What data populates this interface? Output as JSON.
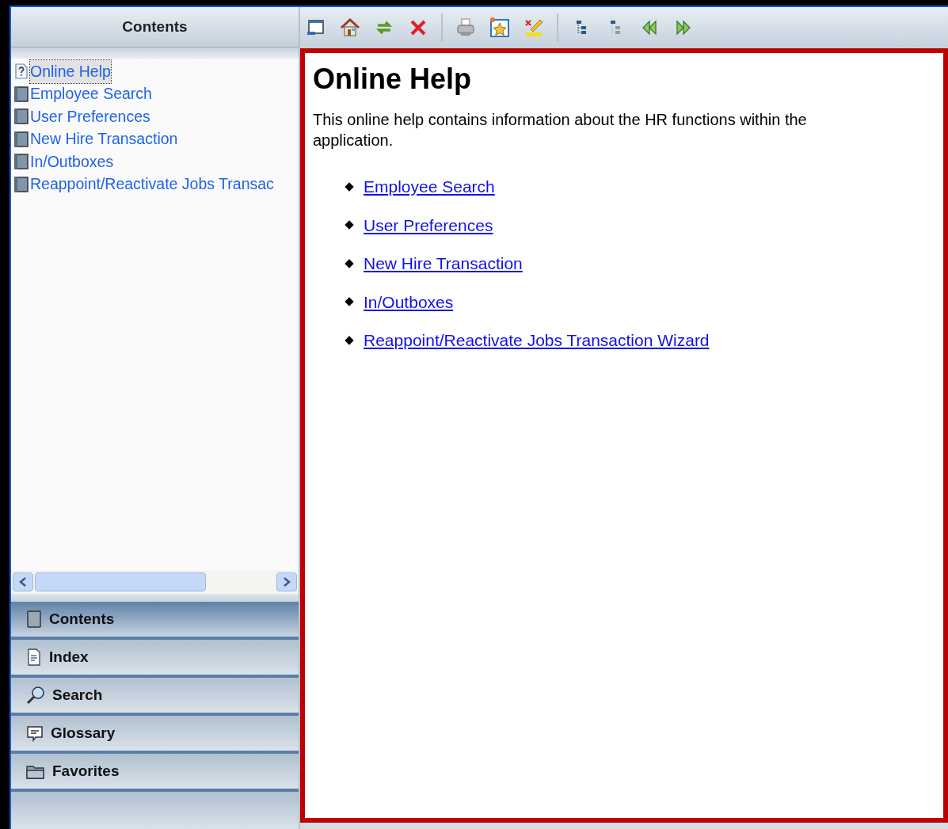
{
  "sidebar": {
    "title": "Contents",
    "tree": [
      {
        "label": "Online Help",
        "kind": "page",
        "selected": true
      },
      {
        "label": "Employee Search",
        "kind": "book",
        "selected": false
      },
      {
        "label": "User Preferences",
        "kind": "book",
        "selected": false
      },
      {
        "label": "New Hire Transaction",
        "kind": "book",
        "selected": false
      },
      {
        "label": "In/Outboxes",
        "kind": "book",
        "selected": false
      },
      {
        "label": "Reappoint/Reactivate Jobs Transac",
        "kind": "book",
        "selected": false
      }
    ],
    "nav_tabs": [
      {
        "label": "Contents",
        "kind": "contents",
        "selected": true
      },
      {
        "label": "Index",
        "kind": "index",
        "selected": false
      },
      {
        "label": "Search",
        "kind": "search",
        "selected": false
      },
      {
        "label": "Glossary",
        "kind": "glossary",
        "selected": false
      },
      {
        "label": "Favorites",
        "kind": "favorites",
        "selected": false
      }
    ]
  },
  "content": {
    "title": "Online Help",
    "intro": "This online help contains information about the HR functions within the application.",
    "links": [
      "Employee Search",
      "User Preferences",
      "New Hire Transaction",
      "In/Outboxes",
      "Reappoint/Reactivate Jobs Transaction Wizard"
    ]
  }
}
